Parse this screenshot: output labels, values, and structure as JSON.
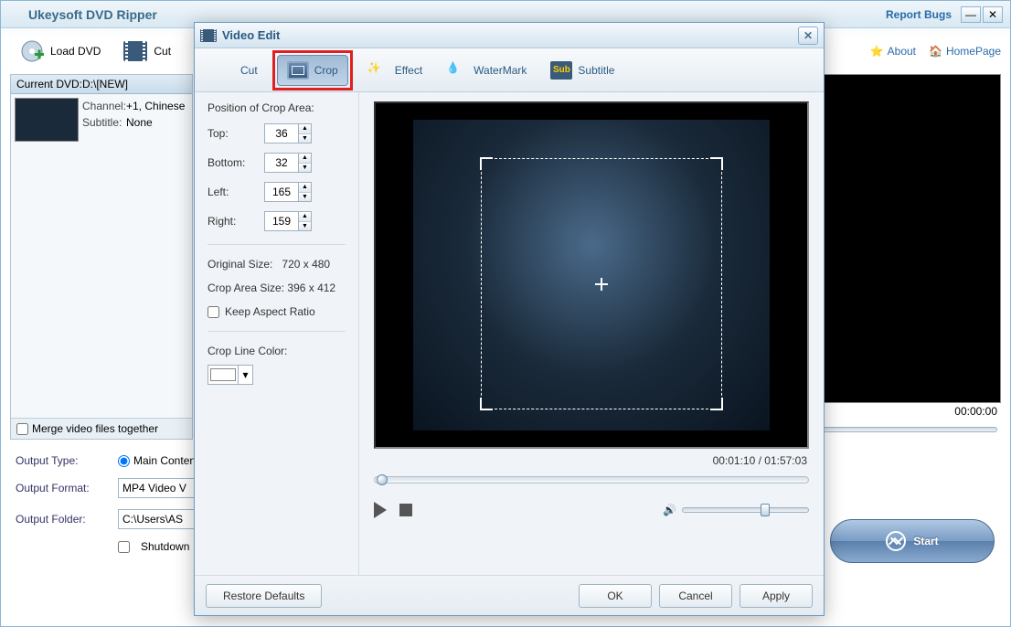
{
  "main": {
    "title": "Ukeysoft DVD Ripper",
    "report_bugs": "Report Bugs",
    "toolbar": {
      "load_dvd": "Load DVD",
      "cut": "Cut",
      "about": "About",
      "homepage": "HomePage"
    },
    "left": {
      "header": "Current DVD:D:\\[NEW]",
      "channel_lbl": "Channel:",
      "channel_val": "+1, Chinese",
      "subtitle_lbl": "Subtitle:",
      "subtitle_val": "None",
      "merge": "Merge video files together"
    },
    "right": {
      "time": "00:00:00"
    },
    "output": {
      "type_lbl": "Output Type:",
      "type_val": "Main Content",
      "format_lbl": "Output Format:",
      "format_val": "MP4 Video V",
      "folder_lbl": "Output Folder:",
      "folder_val": "C:\\Users\\AS",
      "shutdown": "Shutdown"
    },
    "start": "Start"
  },
  "dialog": {
    "title": "Video Edit",
    "tabs": {
      "cut": "Cut",
      "crop": "Crop",
      "effect": "Effect",
      "watermark": "WaterMark",
      "subtitle": "Subtitle"
    },
    "side": {
      "position_title": "Position of Crop Area:",
      "top_lbl": "Top:",
      "top_val": "36",
      "bottom_lbl": "Bottom:",
      "bottom_val": "32",
      "left_lbl": "Left:",
      "left_val": "165",
      "right_lbl": "Right:",
      "right_val": "159",
      "orig_lbl": "Original Size:",
      "orig_val": "720 x 480",
      "crop_lbl": "Crop Area Size:",
      "crop_val": "396 x 412",
      "keep_ar": "Keep Aspect Ratio",
      "color_lbl": "Crop Line Color:"
    },
    "main": {
      "time": "00:01:10 / 01:57:03"
    },
    "footer": {
      "restore": "Restore Defaults",
      "ok": "OK",
      "cancel": "Cancel",
      "apply": "Apply"
    }
  }
}
